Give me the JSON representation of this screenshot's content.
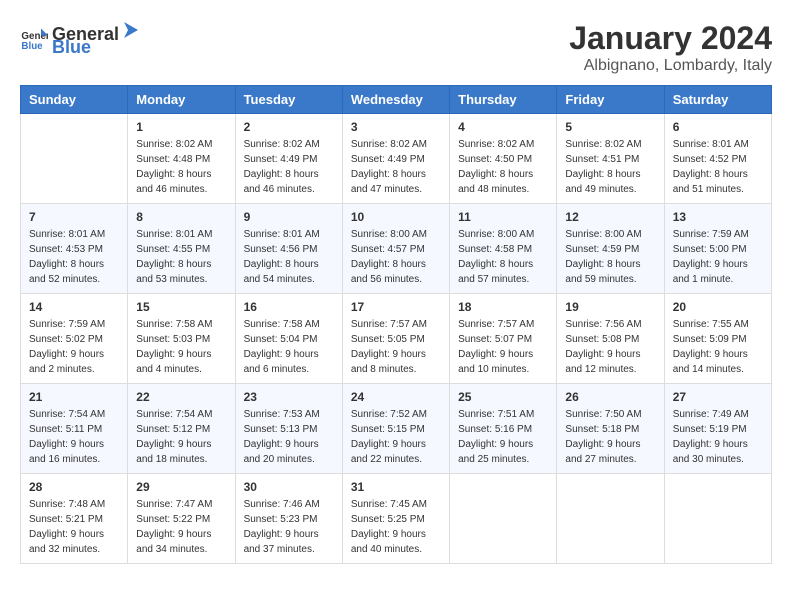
{
  "header": {
    "logo_general": "General",
    "logo_blue": "Blue",
    "month": "January 2024",
    "location": "Albignano, Lombardy, Italy"
  },
  "weekdays": [
    "Sunday",
    "Monday",
    "Tuesday",
    "Wednesday",
    "Thursday",
    "Friday",
    "Saturday"
  ],
  "weeks": [
    [
      {
        "day": "",
        "sunrise": "",
        "sunset": "",
        "daylight": ""
      },
      {
        "day": "1",
        "sunrise": "Sunrise: 8:02 AM",
        "sunset": "Sunset: 4:48 PM",
        "daylight": "Daylight: 8 hours and 46 minutes."
      },
      {
        "day": "2",
        "sunrise": "Sunrise: 8:02 AM",
        "sunset": "Sunset: 4:49 PM",
        "daylight": "Daylight: 8 hours and 46 minutes."
      },
      {
        "day": "3",
        "sunrise": "Sunrise: 8:02 AM",
        "sunset": "Sunset: 4:49 PM",
        "daylight": "Daylight: 8 hours and 47 minutes."
      },
      {
        "day": "4",
        "sunrise": "Sunrise: 8:02 AM",
        "sunset": "Sunset: 4:50 PM",
        "daylight": "Daylight: 8 hours and 48 minutes."
      },
      {
        "day": "5",
        "sunrise": "Sunrise: 8:02 AM",
        "sunset": "Sunset: 4:51 PM",
        "daylight": "Daylight: 8 hours and 49 minutes."
      },
      {
        "day": "6",
        "sunrise": "Sunrise: 8:01 AM",
        "sunset": "Sunset: 4:52 PM",
        "daylight": "Daylight: 8 hours and 51 minutes."
      }
    ],
    [
      {
        "day": "7",
        "sunrise": "Sunrise: 8:01 AM",
        "sunset": "Sunset: 4:53 PM",
        "daylight": "Daylight: 8 hours and 52 minutes."
      },
      {
        "day": "8",
        "sunrise": "Sunrise: 8:01 AM",
        "sunset": "Sunset: 4:55 PM",
        "daylight": "Daylight: 8 hours and 53 minutes."
      },
      {
        "day": "9",
        "sunrise": "Sunrise: 8:01 AM",
        "sunset": "Sunset: 4:56 PM",
        "daylight": "Daylight: 8 hours and 54 minutes."
      },
      {
        "day": "10",
        "sunrise": "Sunrise: 8:00 AM",
        "sunset": "Sunset: 4:57 PM",
        "daylight": "Daylight: 8 hours and 56 minutes."
      },
      {
        "day": "11",
        "sunrise": "Sunrise: 8:00 AM",
        "sunset": "Sunset: 4:58 PM",
        "daylight": "Daylight: 8 hours and 57 minutes."
      },
      {
        "day": "12",
        "sunrise": "Sunrise: 8:00 AM",
        "sunset": "Sunset: 4:59 PM",
        "daylight": "Daylight: 8 hours and 59 minutes."
      },
      {
        "day": "13",
        "sunrise": "Sunrise: 7:59 AM",
        "sunset": "Sunset: 5:00 PM",
        "daylight": "Daylight: 9 hours and 1 minute."
      }
    ],
    [
      {
        "day": "14",
        "sunrise": "Sunrise: 7:59 AM",
        "sunset": "Sunset: 5:02 PM",
        "daylight": "Daylight: 9 hours and 2 minutes."
      },
      {
        "day": "15",
        "sunrise": "Sunrise: 7:58 AM",
        "sunset": "Sunset: 5:03 PM",
        "daylight": "Daylight: 9 hours and 4 minutes."
      },
      {
        "day": "16",
        "sunrise": "Sunrise: 7:58 AM",
        "sunset": "Sunset: 5:04 PM",
        "daylight": "Daylight: 9 hours and 6 minutes."
      },
      {
        "day": "17",
        "sunrise": "Sunrise: 7:57 AM",
        "sunset": "Sunset: 5:05 PM",
        "daylight": "Daylight: 9 hours and 8 minutes."
      },
      {
        "day": "18",
        "sunrise": "Sunrise: 7:57 AM",
        "sunset": "Sunset: 5:07 PM",
        "daylight": "Daylight: 9 hours and 10 minutes."
      },
      {
        "day": "19",
        "sunrise": "Sunrise: 7:56 AM",
        "sunset": "Sunset: 5:08 PM",
        "daylight": "Daylight: 9 hours and 12 minutes."
      },
      {
        "day": "20",
        "sunrise": "Sunrise: 7:55 AM",
        "sunset": "Sunset: 5:09 PM",
        "daylight": "Daylight: 9 hours and 14 minutes."
      }
    ],
    [
      {
        "day": "21",
        "sunrise": "Sunrise: 7:54 AM",
        "sunset": "Sunset: 5:11 PM",
        "daylight": "Daylight: 9 hours and 16 minutes."
      },
      {
        "day": "22",
        "sunrise": "Sunrise: 7:54 AM",
        "sunset": "Sunset: 5:12 PM",
        "daylight": "Daylight: 9 hours and 18 minutes."
      },
      {
        "day": "23",
        "sunrise": "Sunrise: 7:53 AM",
        "sunset": "Sunset: 5:13 PM",
        "daylight": "Daylight: 9 hours and 20 minutes."
      },
      {
        "day": "24",
        "sunrise": "Sunrise: 7:52 AM",
        "sunset": "Sunset: 5:15 PM",
        "daylight": "Daylight: 9 hours and 22 minutes."
      },
      {
        "day": "25",
        "sunrise": "Sunrise: 7:51 AM",
        "sunset": "Sunset: 5:16 PM",
        "daylight": "Daylight: 9 hours and 25 minutes."
      },
      {
        "day": "26",
        "sunrise": "Sunrise: 7:50 AM",
        "sunset": "Sunset: 5:18 PM",
        "daylight": "Daylight: 9 hours and 27 minutes."
      },
      {
        "day": "27",
        "sunrise": "Sunrise: 7:49 AM",
        "sunset": "Sunset: 5:19 PM",
        "daylight": "Daylight: 9 hours and 30 minutes."
      }
    ],
    [
      {
        "day": "28",
        "sunrise": "Sunrise: 7:48 AM",
        "sunset": "Sunset: 5:21 PM",
        "daylight": "Daylight: 9 hours and 32 minutes."
      },
      {
        "day": "29",
        "sunrise": "Sunrise: 7:47 AM",
        "sunset": "Sunset: 5:22 PM",
        "daylight": "Daylight: 9 hours and 34 minutes."
      },
      {
        "day": "30",
        "sunrise": "Sunrise: 7:46 AM",
        "sunset": "Sunset: 5:23 PM",
        "daylight": "Daylight: 9 hours and 37 minutes."
      },
      {
        "day": "31",
        "sunrise": "Sunrise: 7:45 AM",
        "sunset": "Sunset: 5:25 PM",
        "daylight": "Daylight: 9 hours and 40 minutes."
      },
      {
        "day": "",
        "sunrise": "",
        "sunset": "",
        "daylight": ""
      },
      {
        "day": "",
        "sunrise": "",
        "sunset": "",
        "daylight": ""
      },
      {
        "day": "",
        "sunrise": "",
        "sunset": "",
        "daylight": ""
      }
    ]
  ]
}
